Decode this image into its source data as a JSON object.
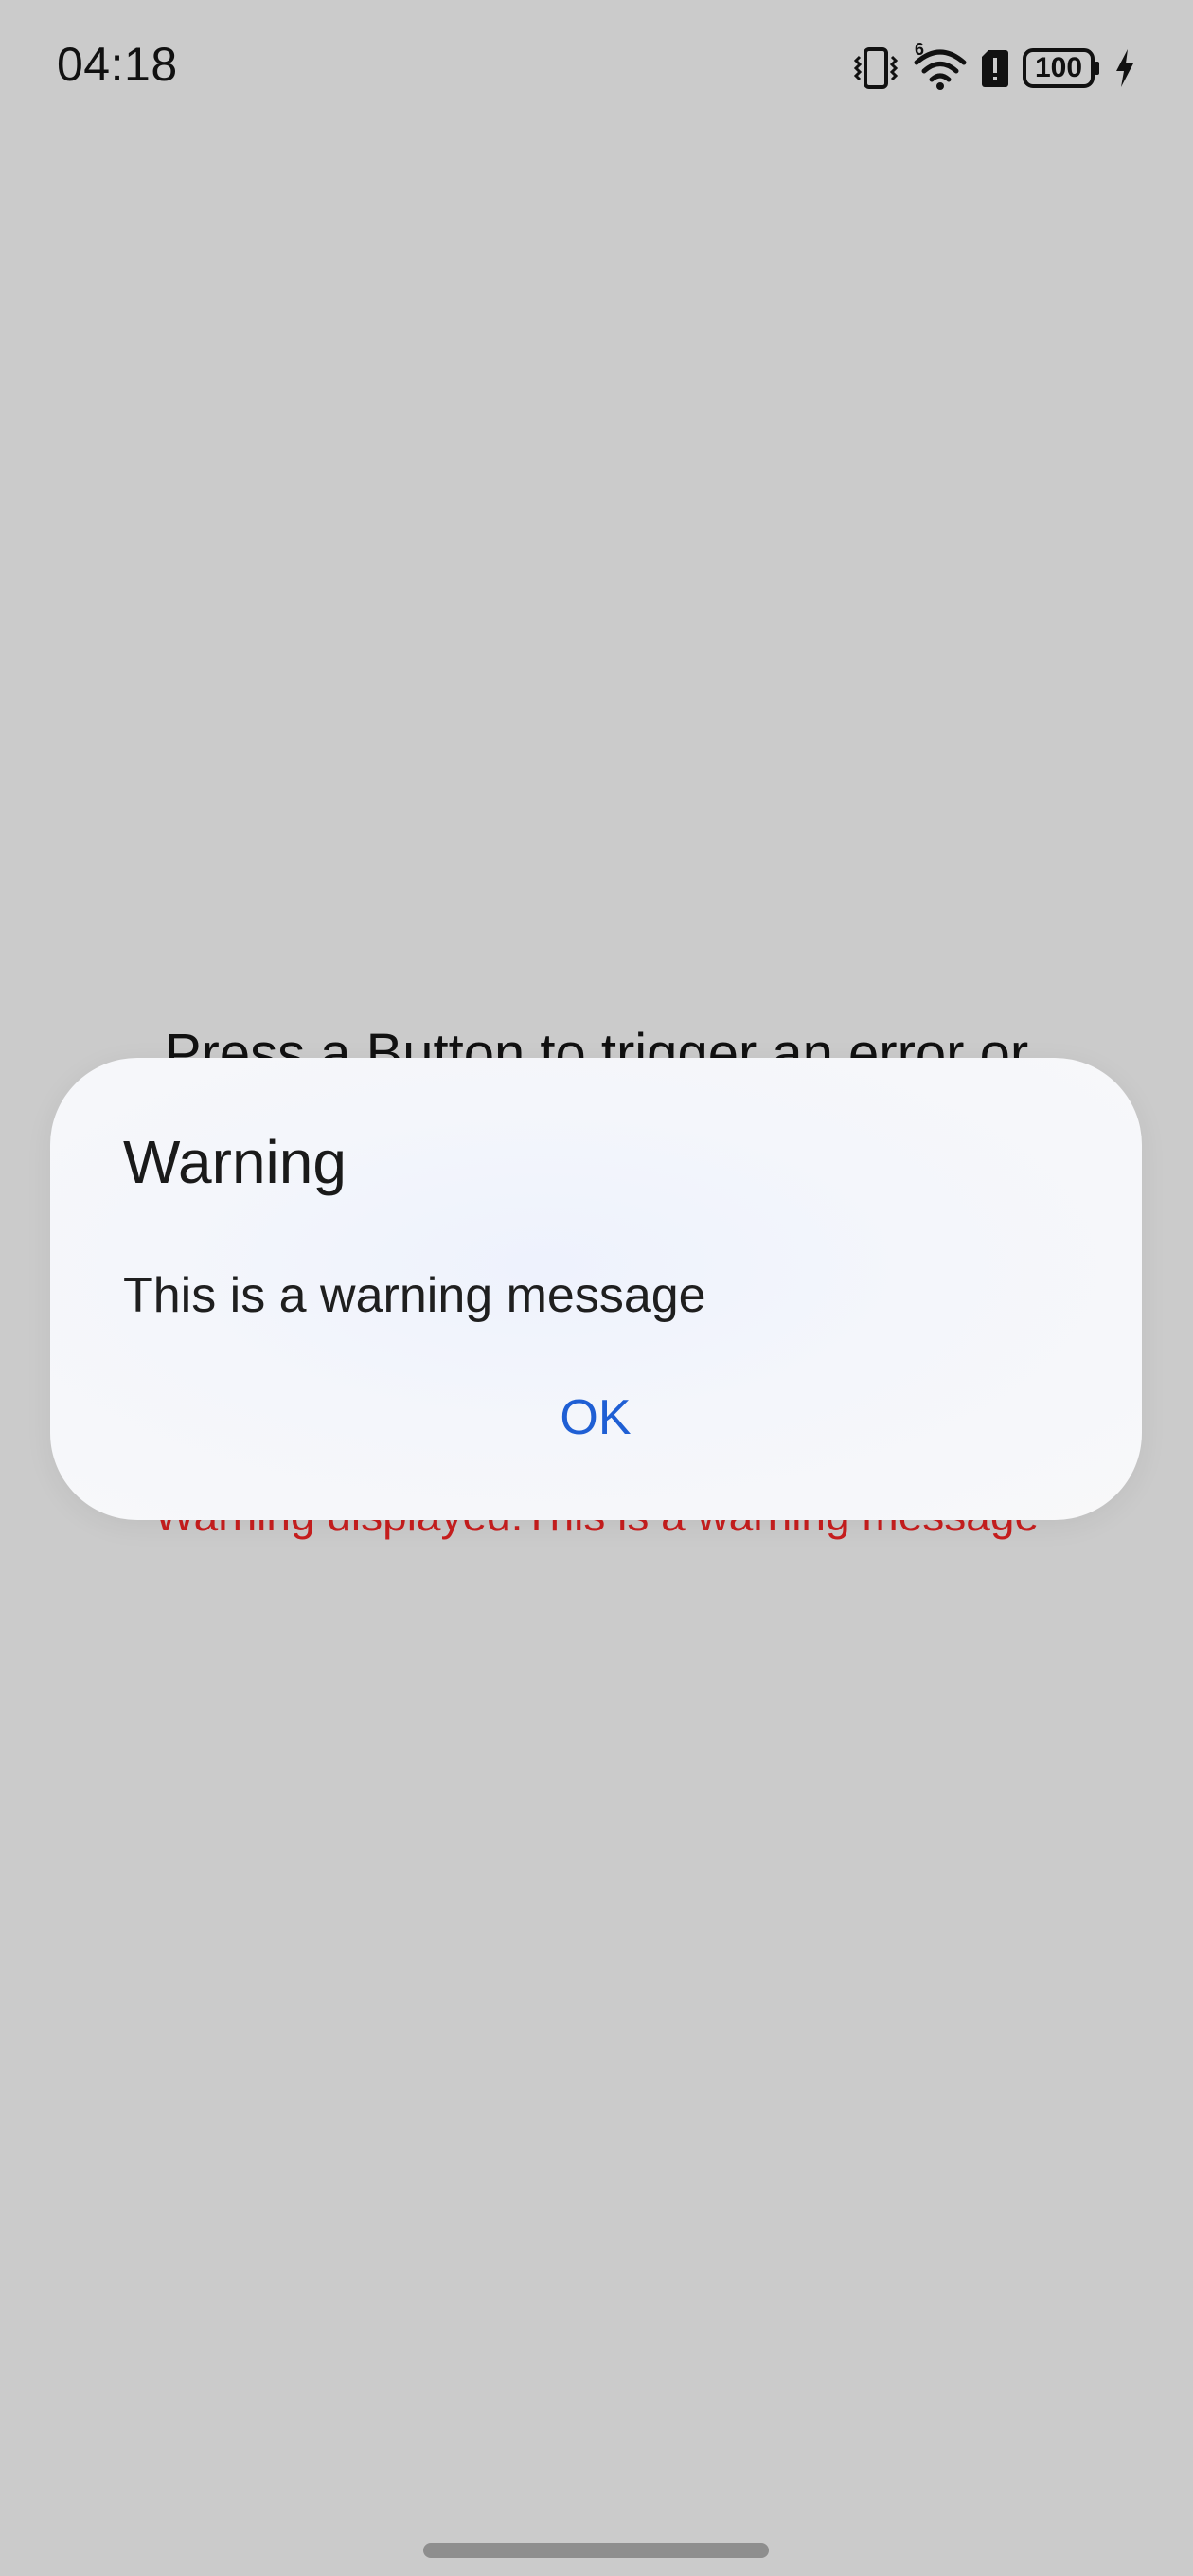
{
  "status_bar": {
    "time": "04:18",
    "network_label": "6",
    "battery_level": "100",
    "icons": [
      "vibrate-icon",
      "wifi-icon",
      "sim-alert-icon",
      "battery-icon",
      "charging-icon"
    ]
  },
  "app": {
    "instruction_text": "Press a Button to trigger an error or",
    "result_text": "Warning displayed:This is a warning message"
  },
  "dialog": {
    "title": "Warning",
    "message": "This is a warning message",
    "ok_label": "OK"
  },
  "colors": {
    "background": "#cbcbcb",
    "result_text": "#c81e1e",
    "ok_button": "#1f5fd4"
  }
}
